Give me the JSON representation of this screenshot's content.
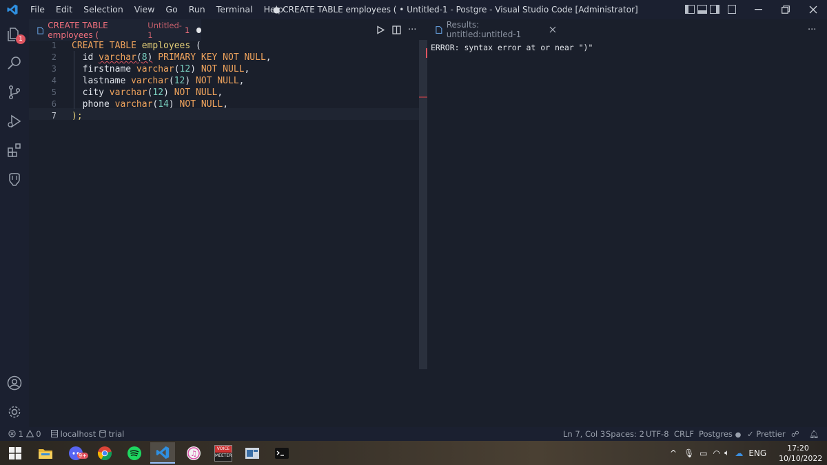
{
  "window": {
    "title": "● CREATE TABLE employees ( • Untitled-1 - Postgre - Visual Studio Code [Administrator]",
    "menu": [
      "File",
      "Edit",
      "Selection",
      "View",
      "Go",
      "Run",
      "Terminal",
      "Help"
    ]
  },
  "activity_bar": {
    "explorer_badge": "1"
  },
  "editor_tab": {
    "title": "CREATE TABLE employees (",
    "subtitle": "Untitled-1",
    "problem_count": "1"
  },
  "code_lines": [
    {
      "n": "1",
      "parts": [
        [
          "kw",
          "CREATE TABLE "
        ],
        [
          "tb",
          "employees"
        ],
        [
          "plain",
          " ("
        ]
      ]
    },
    {
      "n": "2",
      "parts": [
        [
          "plain",
          "  id "
        ],
        [
          "kw",
          "varchar"
        ],
        [
          "plain",
          "("
        ],
        [
          "num",
          "8"
        ],
        [
          "plain",
          ")"
        ],
        [
          "kw",
          " PRIMARY KEY NOT NULL"
        ],
        [
          "plain",
          ","
        ]
      ]
    },
    {
      "n": "3",
      "parts": [
        [
          "plain",
          "  firstname "
        ],
        [
          "kw",
          "varchar"
        ],
        [
          "plain",
          "("
        ],
        [
          "num",
          "12"
        ],
        [
          "plain",
          ")"
        ],
        [
          "kw",
          " NOT NULL"
        ],
        [
          "plain",
          ","
        ]
      ]
    },
    {
      "n": "4",
      "parts": [
        [
          "plain",
          "  lastname "
        ],
        [
          "kw",
          "varchar"
        ],
        [
          "plain",
          "("
        ],
        [
          "num",
          "12"
        ],
        [
          "plain",
          ")"
        ],
        [
          "kw",
          " NOT NULL"
        ],
        [
          "plain",
          ","
        ]
      ]
    },
    {
      "n": "5",
      "parts": [
        [
          "plain",
          "  city "
        ],
        [
          "kw",
          "varchar"
        ],
        [
          "plain",
          "("
        ],
        [
          "num",
          "12"
        ],
        [
          "plain",
          ")"
        ],
        [
          "kw",
          " NOT NULL"
        ],
        [
          "plain",
          ","
        ]
      ]
    },
    {
      "n": "6",
      "parts": [
        [
          "plain",
          "  phone "
        ],
        [
          "kw",
          "varchar"
        ],
        [
          "plain",
          "("
        ],
        [
          "num",
          "14"
        ],
        [
          "plain",
          ")"
        ],
        [
          "kw",
          " NOT NULL"
        ],
        [
          "plain",
          ","
        ]
      ]
    },
    {
      "n": "7",
      "parts": [
        [
          "tb",
          ");"
        ]
      ]
    }
  ],
  "results_tab": {
    "title": "Results: untitled:untitled-1"
  },
  "results": {
    "error": "ERROR: syntax error at or near \")\""
  },
  "statusbar": {
    "errors": "1",
    "warnings": "0",
    "connection": "localhost",
    "database": "trial",
    "position": "Ln 7, Col 3",
    "spaces": "Spaces: 2",
    "encoding": "UTF-8",
    "eol": "CRLF",
    "language": "Postgres",
    "formatter": "Prettier"
  },
  "taskbar": {
    "voicemeeter_top": "VOICE",
    "voicemeeter_bottom": "MEETER",
    "language": "ENG",
    "time": "17:20",
    "date": "10/10/2022",
    "discord_badge": "9+"
  }
}
